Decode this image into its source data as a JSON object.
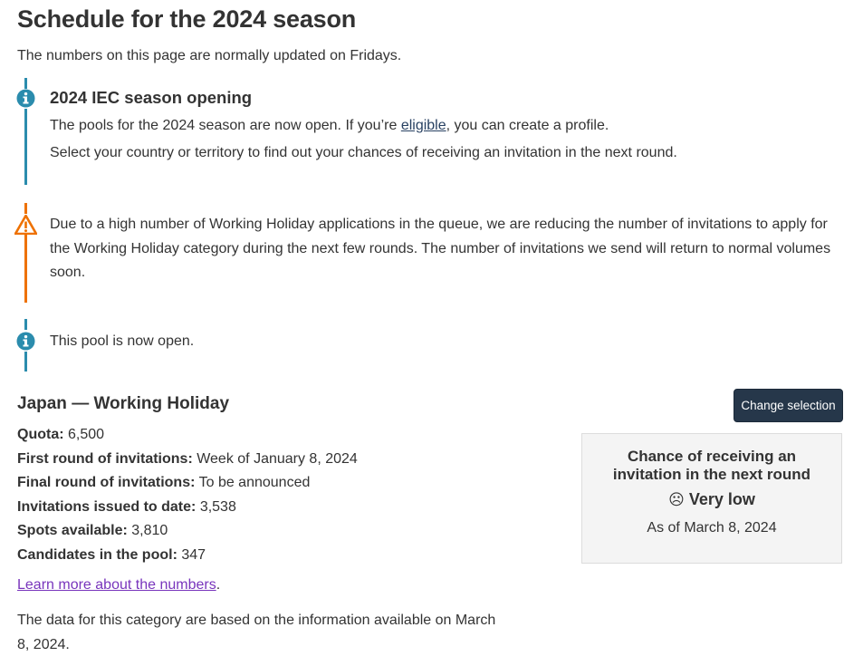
{
  "page": {
    "title": "Schedule for the 2024 season",
    "intro": "The numbers on this page are normally updated on Fridays."
  },
  "alerts": {
    "season_opening": {
      "heading": "2024 IEC season opening",
      "line1_before": "The pools for the 2024 season are now open. If you’re ",
      "line1_link": "eligible",
      "line1_after": ", you can create a profile.",
      "line2": "Select your country or territory to find out your chances of receiving an invitation in the next round.",
      "icon": "info-icon",
      "color": "#2b8cad"
    },
    "warning": {
      "text": "Due to a high number of Working Holiday applications in the queue, we are reducing the number of invitations to apply for the Working Holiday category during the next few rounds. The number of invitations we send will return to normal volumes soon.",
      "icon": "warning-icon",
      "color": "#ee7100"
    },
    "pool_open": {
      "text": "This pool is now open.",
      "icon": "info-icon",
      "color": "#2b8cad"
    }
  },
  "selection": {
    "title": "Japan — Working Holiday",
    "button_label": "Change selection"
  },
  "stats": [
    {
      "label": "Quota:",
      "value": "6,500"
    },
    {
      "label": "First round of invitations:",
      "value": "Week of January 8, 2024"
    },
    {
      "label": "Final round of invitations:",
      "value": "To be announced"
    },
    {
      "label": "Invitations issued to date:",
      "value": "3,538"
    },
    {
      "label": "Spots available:",
      "value": "3,810"
    },
    {
      "label": "Candidates in the pool:",
      "value": "347"
    }
  ],
  "chance_card": {
    "title": "Chance of receiving an invitation in the next round",
    "level_icon": "sad-face-icon",
    "level_glyph": "☹",
    "level": "Very low",
    "as_of": "As of March 8, 2024"
  },
  "footer": {
    "learn_more": "Learn more about the numbers",
    "learn_more_suffix": ".",
    "data_note": "The data for this category are based on the information available on March 8, 2024."
  },
  "colors": {
    "link": "#284162",
    "visited_link": "#7834bc",
    "button_bg": "#26374a"
  }
}
